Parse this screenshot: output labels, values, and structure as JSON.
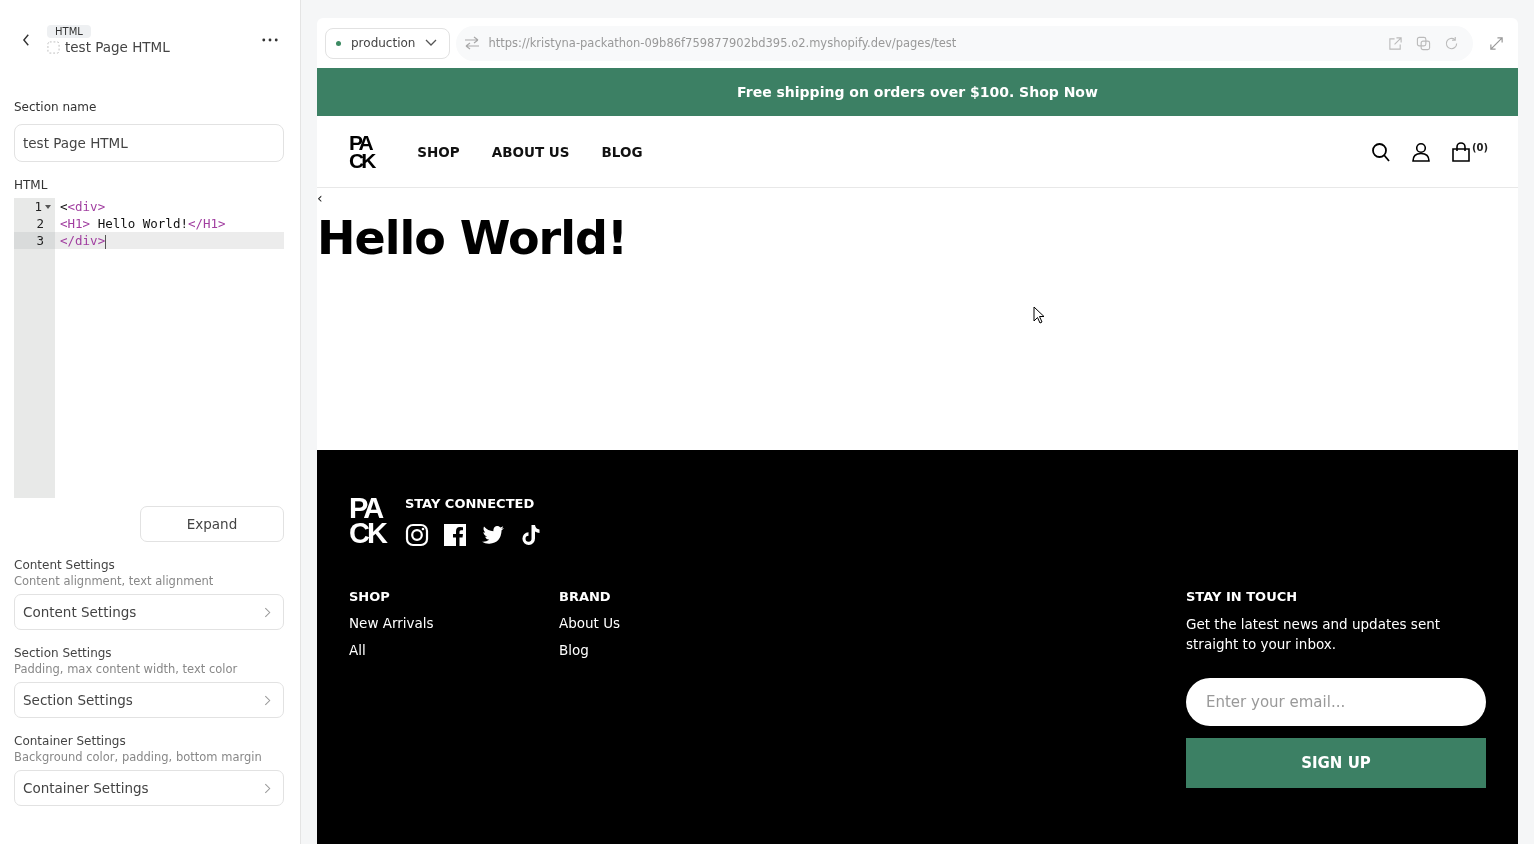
{
  "editor": {
    "badge": "HTML",
    "title": "test Page HTML",
    "section_name_label": "Section name",
    "section_name_value": "test Page HTML",
    "html_label": "HTML",
    "code_lines": [
      {
        "number": "1",
        "foldable": true,
        "active": false,
        "tokens": [
          {
            "kind": "text",
            "text": "<"
          },
          {
            "kind": "tag",
            "text": "<div>"
          }
        ]
      },
      {
        "number": "2",
        "foldable": false,
        "active": false,
        "tokens": [
          {
            "kind": "tag",
            "text": "<H1>"
          },
          {
            "kind": "text",
            "text": " Hello World!"
          },
          {
            "kind": "tag",
            "text": "</H1>"
          }
        ]
      },
      {
        "number": "3",
        "foldable": false,
        "active": true,
        "tokens": [
          {
            "kind": "tag",
            "text": "</div>"
          }
        ]
      }
    ],
    "expand_button": "Expand",
    "settings": [
      {
        "title": "Content Settings",
        "description": "Content alignment, text alignment",
        "button": "Content Settings"
      },
      {
        "title": "Section Settings",
        "description": "Padding, max content width, text color",
        "button": "Section Settings"
      },
      {
        "title": "Container Settings",
        "description": "Background color, padding, bottom margin",
        "button": "Container Settings"
      }
    ]
  },
  "preview": {
    "environment": "production",
    "url": "https://kristyna-packathon-09b86f759877902bd395.o2.myshopify.dev/pages/test",
    "announcement": "Free shipping on orders over $100. Shop Now",
    "logo": [
      "PA",
      "CK"
    ],
    "nav": [
      "SHOP",
      "ABOUT US",
      "BLOG"
    ],
    "cart_count": "(0)",
    "back_mark": "‹",
    "heading": "Hello World!",
    "footer": {
      "logo": [
        "PA",
        "CK"
      ],
      "social_title": "STAY CONNECTED",
      "columns": [
        {
          "title": "SHOP",
          "links": [
            "New Arrivals",
            "All"
          ]
        },
        {
          "title": "BRAND",
          "links": [
            "About Us",
            "Blog"
          ]
        }
      ],
      "newsletter": {
        "title": "STAY IN TOUCH",
        "text": "Get the latest news and updates sent straight to your inbox.",
        "placeholder": "Enter your email...",
        "button": "SIGN UP"
      }
    }
  }
}
